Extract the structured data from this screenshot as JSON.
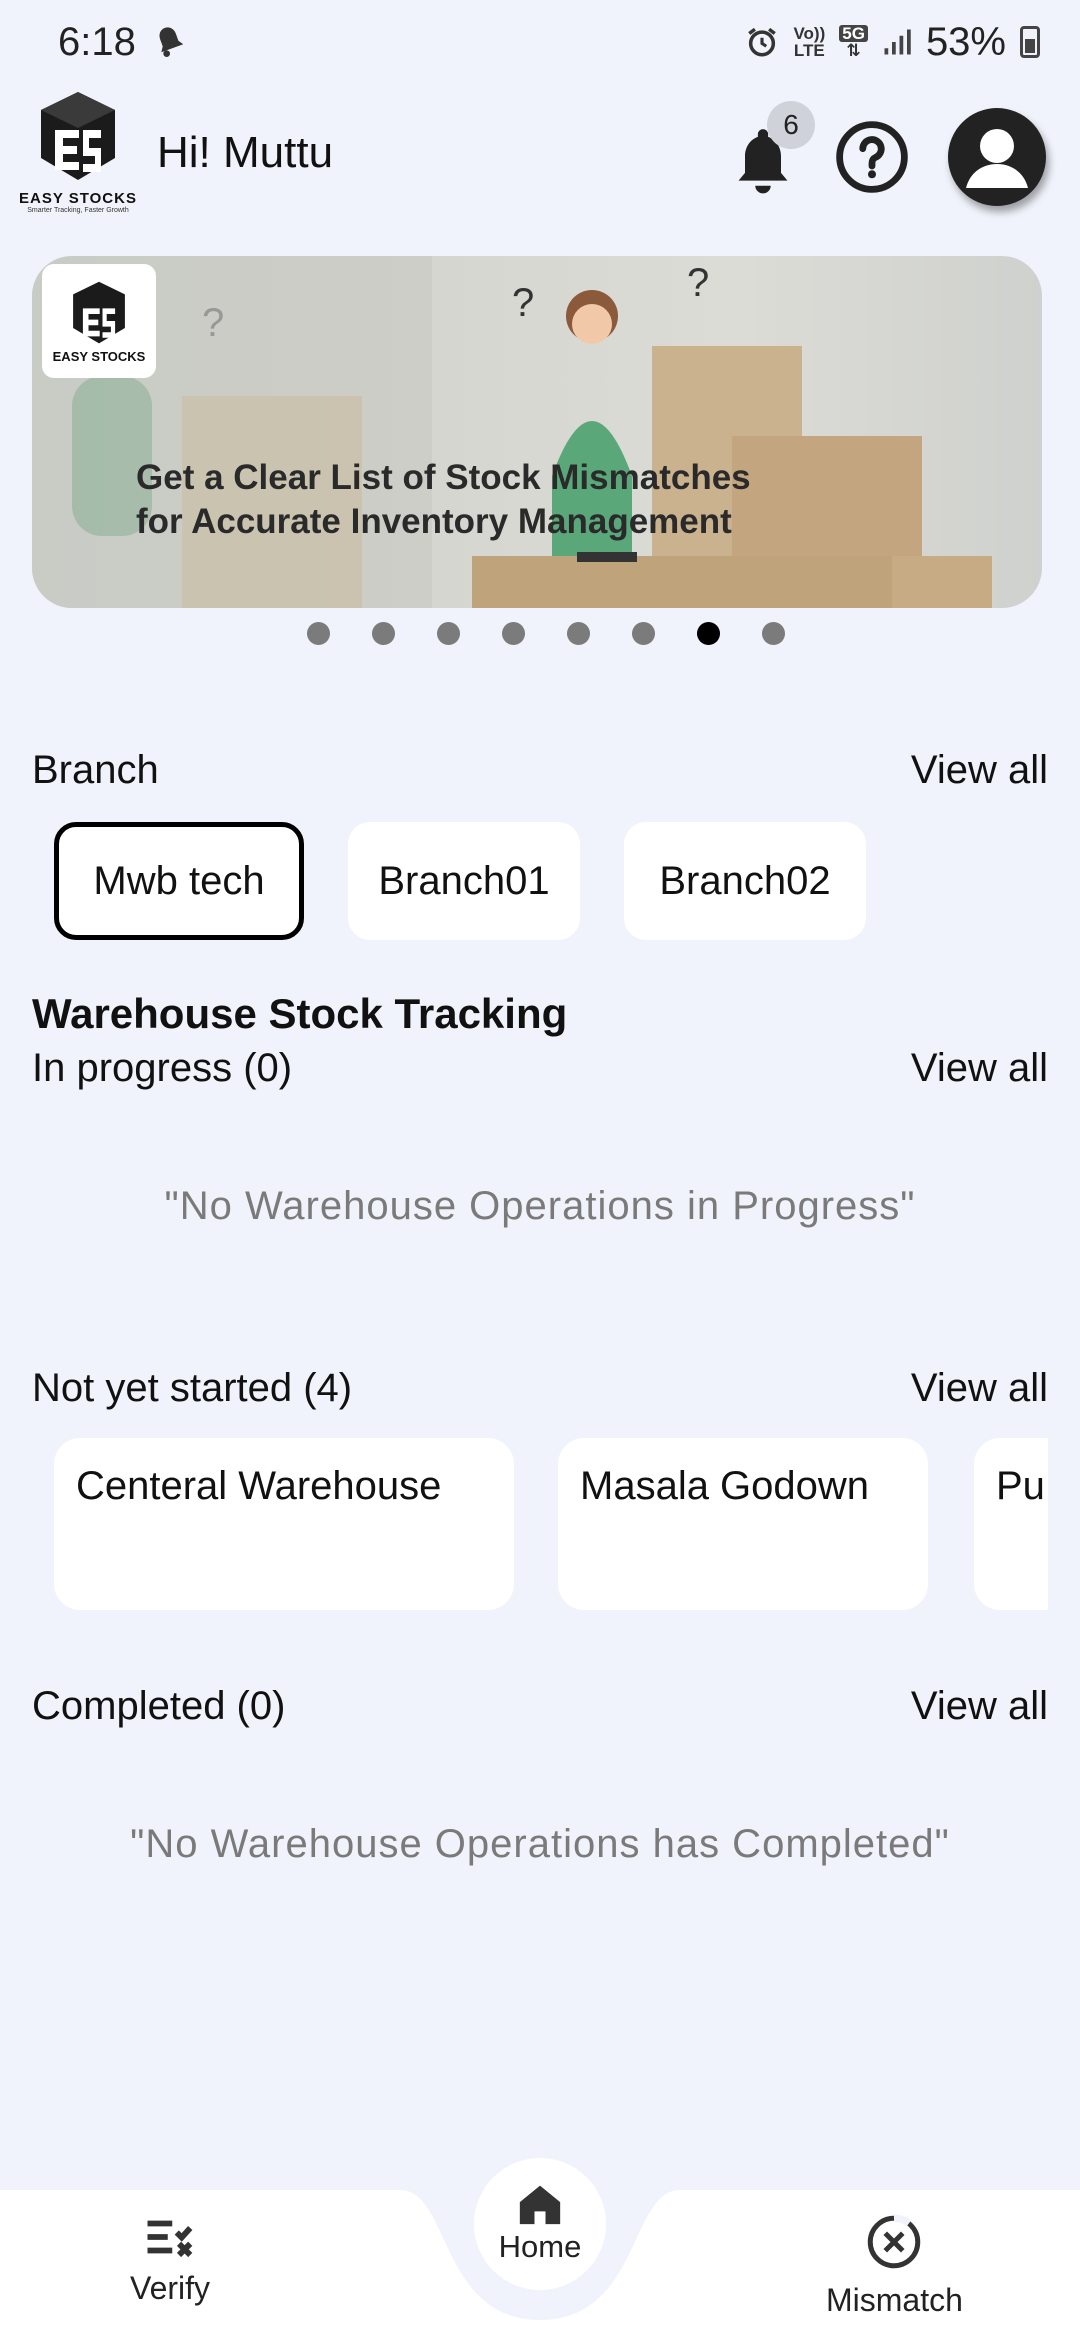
{
  "status_bar": {
    "time": "6:18",
    "network_top": "Vo))",
    "network_bottom": "LTE",
    "network_5g": "5G",
    "battery": "53%"
  },
  "header": {
    "logo_text": "EASY STOCKS",
    "logo_tagline": "Smarter Tracking, Faster Growth",
    "greeting": "Hi! Muttu",
    "notification_count": "6"
  },
  "banner": {
    "logo_text": "EASY STOCKS",
    "headline_line1": "Get a Clear List of Stock Mismatches",
    "headline_line2": "for Accurate Inventory Management",
    "slide_count": 8,
    "active_slide": 7
  },
  "branch": {
    "label": "Branch",
    "view_all": "View all",
    "items": [
      "Mwb tech",
      "Branch01",
      "Branch02"
    ],
    "selected": "Mwb tech"
  },
  "tracking": {
    "title": "Warehouse Stock Tracking",
    "in_progress": {
      "label": "In progress (0)",
      "view_all": "View all",
      "empty": "\"No Warehouse Operations in Progress\""
    },
    "not_started": {
      "label": "Not yet started (4)",
      "view_all": "View all",
      "cards": [
        "Centeral Warehouse",
        "Masala Godown",
        "Pu"
      ]
    },
    "completed": {
      "label": "Completed (0)",
      "view_all": "View all",
      "empty": "\"No Warehouse Operations has Completed\""
    }
  },
  "nav": {
    "verify": "Verify",
    "home": "Home",
    "mismatch": "Mismatch"
  }
}
